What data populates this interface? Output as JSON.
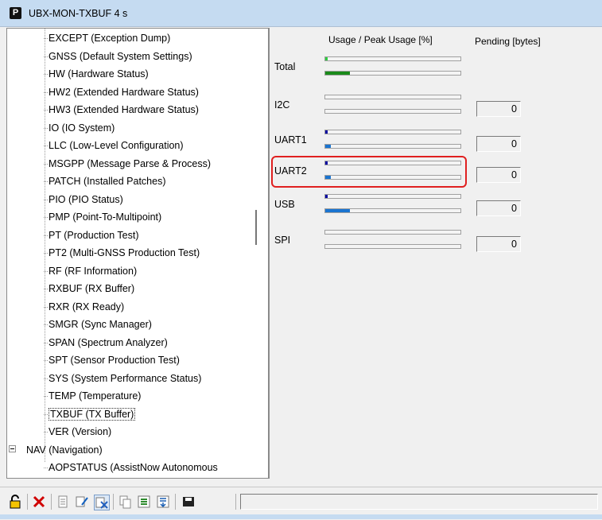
{
  "window": {
    "title": "UBX-MON-TXBUF 4 s",
    "app_icon": "P"
  },
  "tree": {
    "items": [
      "EXCEPT (Exception Dump)",
      "GNSS (Default System Settings)",
      "HW (Hardware Status)",
      "HW2 (Extended Hardware Status)",
      "HW3 (Extended Hardware Status)",
      "IO (IO System)",
      "LLC (Low-Level Configuration)",
      "MSGPP (Message Parse & Process)",
      "PATCH (Installed Patches)",
      "PIO (PIO Status)",
      "PMP (Point-To-Multipoint)",
      "PT (Production Test)",
      "PT2 (Multi-GNSS Production Test)",
      "RF (RF Information)",
      "RXBUF (RX Buffer)",
      "RXR (RX Ready)",
      "SMGR (Sync Manager)",
      "SPAN (Spectrum Analyzer)",
      "SPT (Sensor Production Test)",
      "SYS  (System Performance Status)",
      "TEMP (Temperature)",
      "TXBUF (TX Buffer)",
      "VER (Version)"
    ],
    "selected": "TXBUF (TX Buffer)",
    "parent": "NAV (Navigation)",
    "child_partial": "AOPSTATUS (AssistNow Autonomous"
  },
  "panel": {
    "usage_header": "Usage / Peak Usage [%]",
    "pending_header": "Pending [bytes]",
    "ports": [
      {
        "label": "Total",
        "usage": 2,
        "peak": 18,
        "pending": "",
        "usage_color": "#2ecc40",
        "peak_color": "#1a8a1a"
      },
      {
        "label": "I2C",
        "usage": 0,
        "peak": 0,
        "pending": "0",
        "usage_color": "#0000a0",
        "peak_color": "#1a74d0"
      },
      {
        "label": "UART1",
        "usage": 2,
        "peak": 4,
        "pending": "0",
        "usage_color": "#0000a0",
        "peak_color": "#1a74d0"
      },
      {
        "label": "UART2",
        "usage": 2,
        "peak": 4,
        "pending": "0",
        "usage_color": "#0000a0",
        "peak_color": "#1a74d0"
      },
      {
        "label": "USB",
        "usage": 2,
        "peak": 18,
        "pending": "0",
        "usage_color": "#0000a0",
        "peak_color": "#1a74d0"
      },
      {
        "label": "SPI",
        "usage": 0,
        "peak": 0,
        "pending": "0",
        "usage_color": "#0000a0",
        "peak_color": "#1a74d0"
      }
    ]
  },
  "toolbar": {
    "icons": [
      "lock-icon",
      "delete-icon",
      "copy-icon",
      "edit-icon",
      "toggle-icon",
      "paste-icon",
      "export-icon",
      "list-icon",
      "save-icon"
    ]
  }
}
